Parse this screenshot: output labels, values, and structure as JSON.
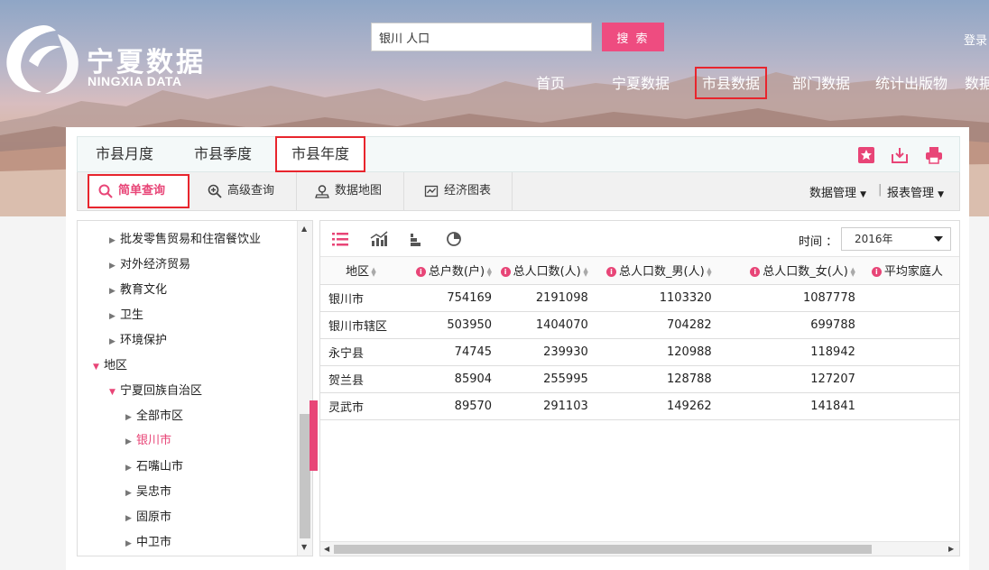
{
  "header": {
    "logo_cn": "宁夏数据",
    "logo_en": "NINGXIA DATA",
    "search_value": "银川 人口",
    "search_button": "搜 索",
    "login": "登录",
    "nav": [
      {
        "label": "首页"
      },
      {
        "label": "宁夏数据"
      },
      {
        "label": "市县数据",
        "active": true
      },
      {
        "label": "部门数据"
      },
      {
        "label": "统计出版物"
      },
      {
        "label": "数据"
      }
    ],
    "brand_color": "#ee4c80",
    "highlight_color": "#e8252d"
  },
  "tabs": [
    {
      "label": "市县月度"
    },
    {
      "label": "市县季度"
    },
    {
      "label": "市县年度",
      "active": true
    }
  ],
  "tab_icons": [
    "star-icon",
    "download-icon",
    "print-icon"
  ],
  "toolbar": {
    "items": [
      {
        "label": "简单查询",
        "icon": "search-icon",
        "active": true
      },
      {
        "label": "高级查询",
        "icon": "zoom-plus-icon"
      },
      {
        "label": "数据地图",
        "icon": "map-pin-icon"
      },
      {
        "label": "经济图表",
        "icon": "chart-icon"
      }
    ],
    "data_manage": "数据管理",
    "report_manage": "报表管理"
  },
  "tree": [
    {
      "label": "批发零售贸易和住宿餐饮业",
      "level": 1,
      "expanded": false
    },
    {
      "label": "对外经济贸易",
      "level": 1,
      "expanded": false
    },
    {
      "label": "教育文化",
      "level": 1,
      "expanded": false
    },
    {
      "label": "卫生",
      "level": 1,
      "expanded": false
    },
    {
      "label": "环境保护",
      "level": 1,
      "expanded": false
    },
    {
      "label": "地区",
      "level": 0,
      "expanded": true
    },
    {
      "label": "宁夏回族自治区",
      "level": 1,
      "expanded": true
    },
    {
      "label": "全部市区",
      "level": 2,
      "expanded": false
    },
    {
      "label": "银川市",
      "level": 2,
      "expanded": false,
      "selected": true
    },
    {
      "label": "石嘴山市",
      "level": 2,
      "expanded": false
    },
    {
      "label": "吴忠市",
      "level": 2,
      "expanded": false
    },
    {
      "label": "固原市",
      "level": 2,
      "expanded": false
    },
    {
      "label": "中卫市",
      "level": 2,
      "expanded": false
    }
  ],
  "view_icons": [
    "table-view-icon",
    "line-chart-icon",
    "bar-chart-icon",
    "pie-chart-icon"
  ],
  "time_label": "时间 ：",
  "time_value": "2016年",
  "table": {
    "columns": [
      "地区",
      "总户数(户)",
      "总人口数(人)",
      "总人口数_男(人)",
      "总人口数_女(人)",
      "平均家庭人"
    ],
    "rows": [
      [
        "银川市",
        "754169",
        "2191098",
        "1103320",
        "1087778",
        ""
      ],
      [
        "银川市辖区",
        "503950",
        "1404070",
        "704282",
        "699788",
        ""
      ],
      [
        "永宁县",
        "74745",
        "239930",
        "120988",
        "118942",
        ""
      ],
      [
        "贺兰县",
        "85904",
        "255995",
        "128788",
        "127207",
        ""
      ],
      [
        "灵武市",
        "89570",
        "291103",
        "149262",
        "141841",
        ""
      ]
    ]
  }
}
